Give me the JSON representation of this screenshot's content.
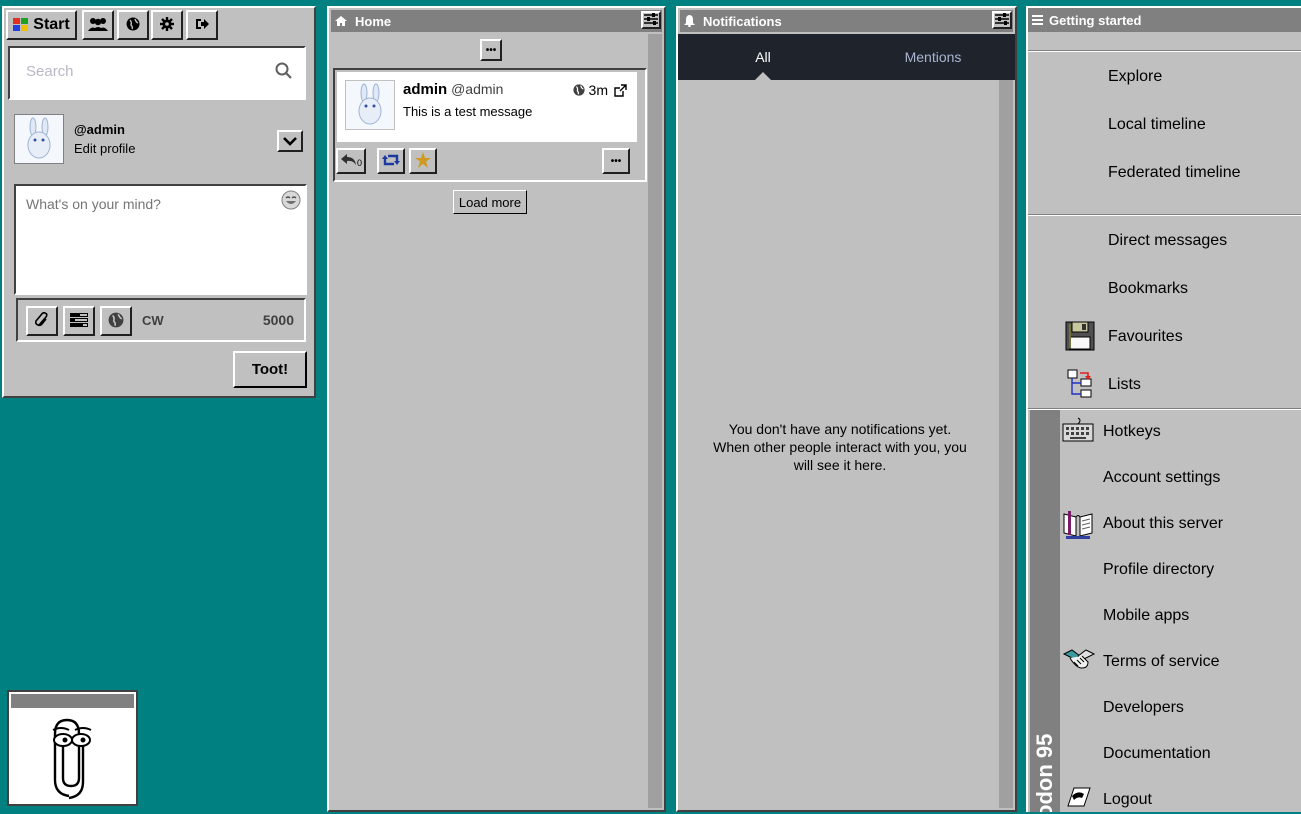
{
  "toolbar": {
    "start_label": "Start"
  },
  "search": {
    "placeholder": "Search"
  },
  "profile": {
    "handle": "@admin",
    "edit_label": "Edit profile"
  },
  "compose": {
    "placeholder": "What's on your mind?",
    "cw_label": "CW",
    "char_count": "5000",
    "toot_label": "Toot!"
  },
  "home": {
    "title": "Home",
    "status": {
      "display_name": "admin",
      "acct": "@admin",
      "time": "3m",
      "content": "This is a test message"
    },
    "load_more": "Load more"
  },
  "notifications": {
    "title": "Notifications",
    "tabs": [
      "All",
      "Mentions"
    ],
    "empty_line1": "You don't have any notifications yet.",
    "empty_line2": "When other people interact with you, you",
    "empty_line3": "will see it here."
  },
  "getting_started": {
    "title": "Getting started",
    "items": [
      "Explore",
      "Local timeline",
      "Federated timeline",
      "Direct messages",
      "Bookmarks",
      "Favourites",
      "Lists"
    ],
    "lower_items": [
      "Hotkeys",
      "Account settings",
      "About this server",
      "Profile directory",
      "Mobile apps",
      "Terms of service",
      "Developers",
      "Documentation",
      "Logout"
    ],
    "brand_vertical": "odon 95"
  },
  "colors": {
    "desktop": "#008080",
    "face": "#c0c0c0",
    "titlebar": "#808080",
    "tabbar": "#1f232b"
  }
}
